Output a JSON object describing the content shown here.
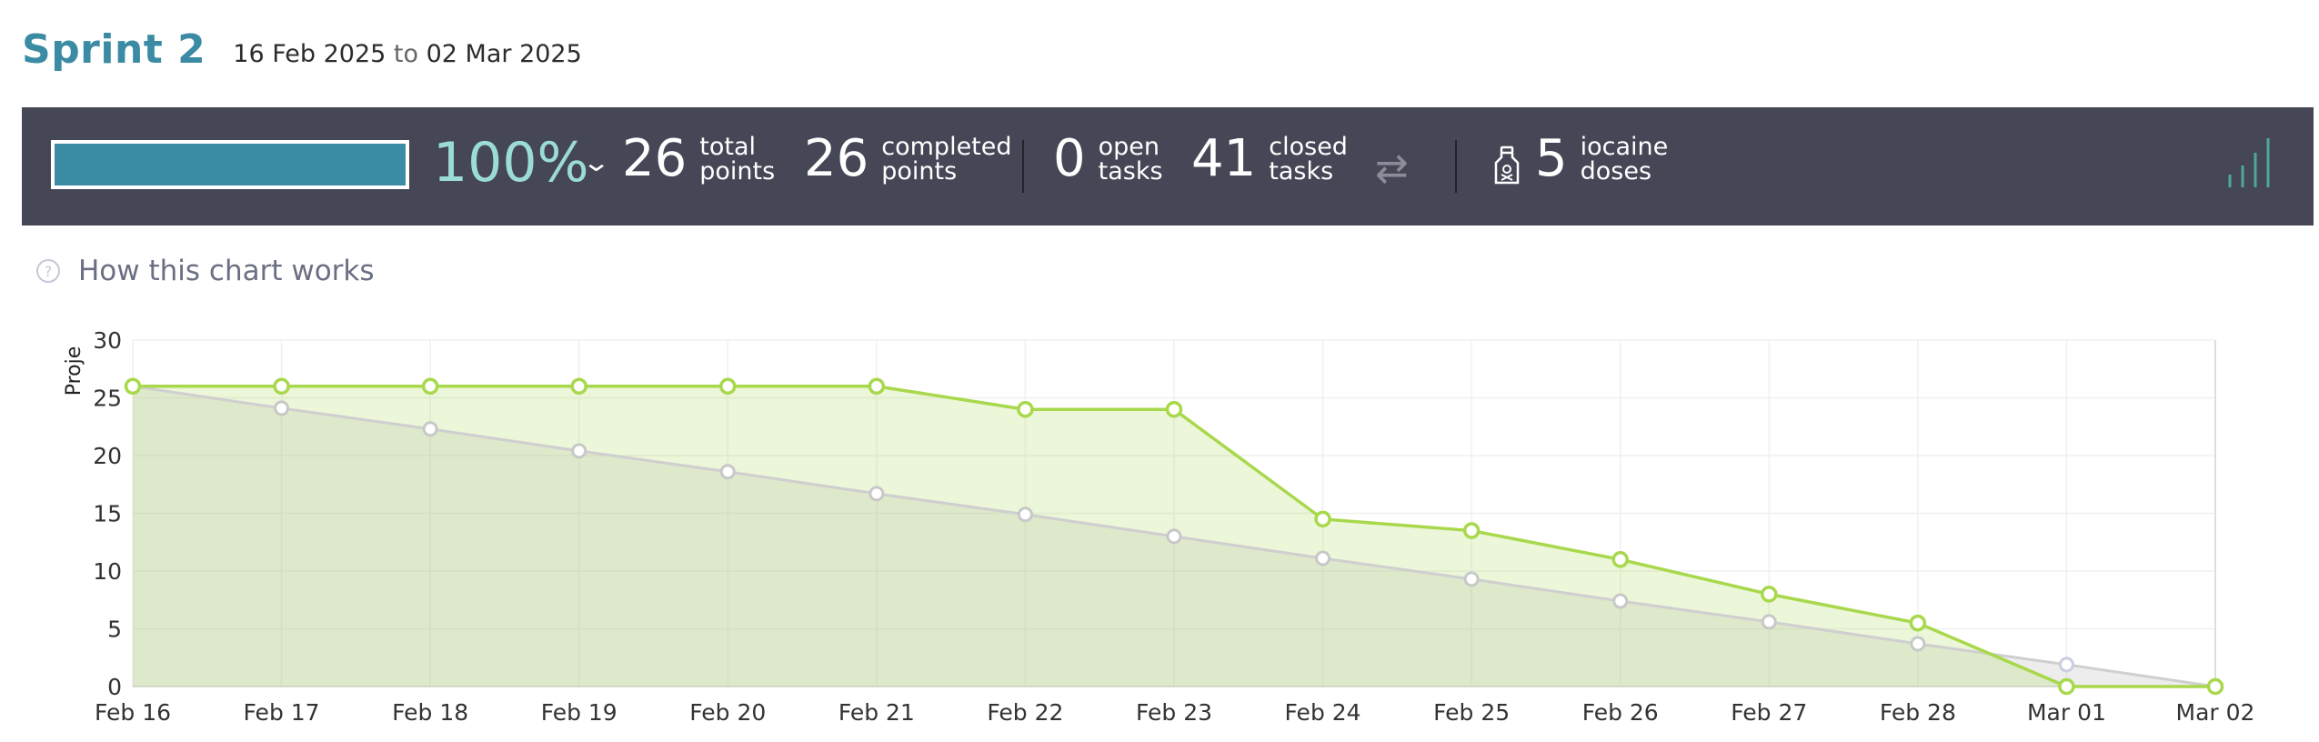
{
  "sprint": {
    "title": "Sprint 2",
    "start": "16 Feb 2025",
    "to": "to",
    "end": "02 Mar 2025"
  },
  "summary": {
    "progress_fraction": 1.0,
    "percent": "100%",
    "total_points": "26",
    "total_points_label": [
      "total",
      "points"
    ],
    "completed_points": "26",
    "completed_points_label": [
      "completed",
      "points"
    ],
    "open_tasks": "0",
    "open_tasks_label": [
      "open",
      "tasks"
    ],
    "closed_tasks": "41",
    "closed_tasks_label": [
      "closed",
      "tasks"
    ],
    "iocaine_doses": "5",
    "iocaine_doses_label": [
      "iocaine",
      "doses"
    ]
  },
  "help": {
    "label": "How this chart works"
  },
  "icons": {
    "dropdown": "chevron-down-icon",
    "swap": "swap-arrows-icon",
    "iocaine": "potion-bottle-icon",
    "graph": "signal-bars-icon",
    "help": "question-circle-icon"
  },
  "colors": {
    "accent": "#3b8ba5",
    "bar_bg": "#454756",
    "percent": "#9cdcd6",
    "real": "#a8d84c",
    "optimal": "#c8c8c8"
  },
  "chart_data": {
    "type": "area",
    "ylabel": "Proje",
    "ylim": [
      0,
      30
    ],
    "yticks": [
      0,
      5,
      10,
      15,
      20,
      25,
      30
    ],
    "categories": [
      "Feb 16",
      "Feb 17",
      "Feb 18",
      "Feb 19",
      "Feb 20",
      "Feb 21",
      "Feb 22",
      "Feb 23",
      "Feb 24",
      "Feb 25",
      "Feb 26",
      "Feb 27",
      "Feb 28",
      "Mar 01",
      "Mar 02"
    ],
    "series": [
      {
        "values": [
          26,
          26,
          26,
          26,
          26,
          26,
          24,
          24,
          14.5,
          13.5,
          11,
          8,
          5.5,
          0,
          0
        ]
      },
      {
        "values": [
          26,
          24.1,
          22.3,
          20.4,
          18.6,
          16.7,
          14.9,
          13,
          11.1,
          9.3,
          7.4,
          5.6,
          3.7,
          1.9,
          0
        ]
      }
    ],
    "grid": true
  }
}
